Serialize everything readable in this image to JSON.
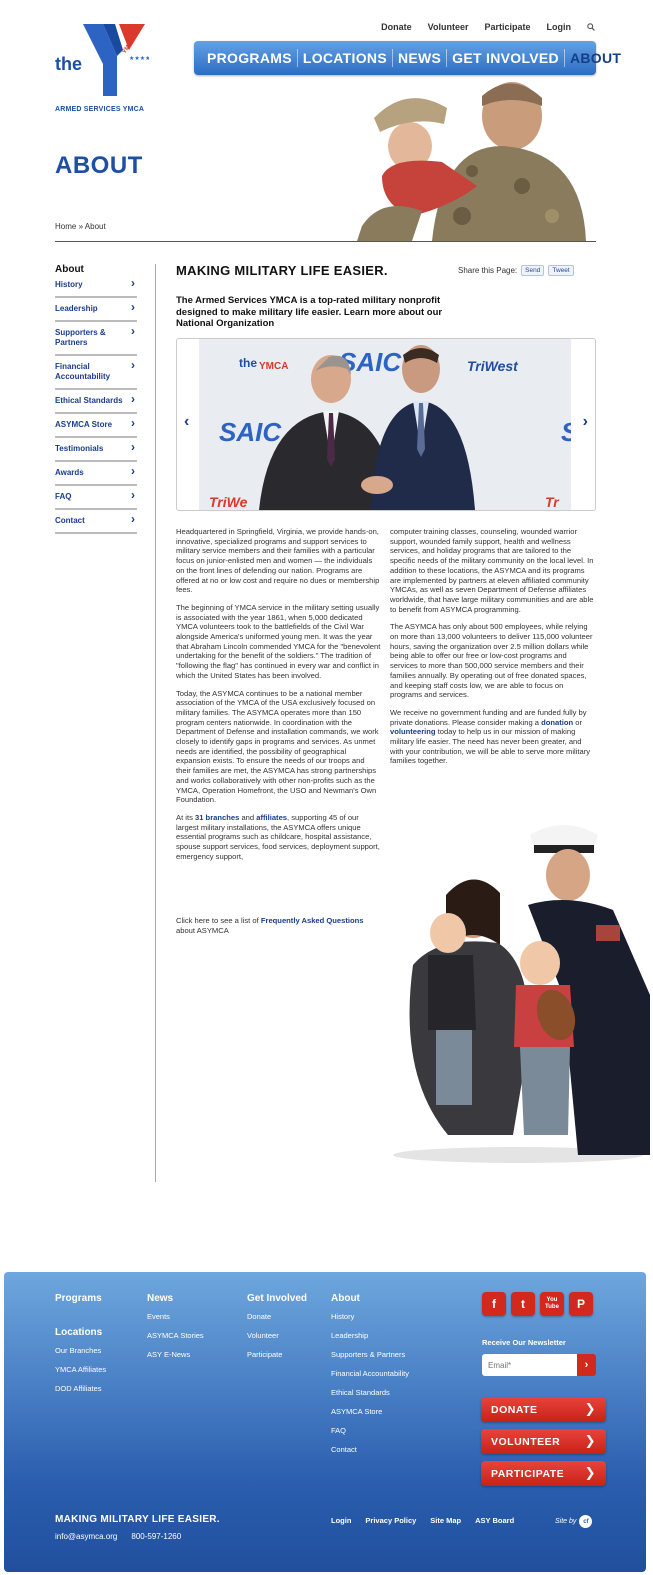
{
  "logo": {
    "the": "the",
    "ymca": "YMCA",
    "org": "ARMED SERVICES YMCA"
  },
  "util_nav": [
    "Donate",
    "Volunteer",
    "Participate",
    "Login"
  ],
  "main_nav": [
    "PROGRAMS",
    "LOCATIONS",
    "NEWS",
    "GET INVOLVED",
    "ABOUT"
  ],
  "page_title": "ABOUT",
  "breadcrumb": "Home » About",
  "sidebar": {
    "heading": "About",
    "items": [
      "History",
      "Leadership",
      "Supporters & Partners",
      "Financial Accountability",
      "Ethical Standards",
      "ASYMCA Store",
      "Testimonials",
      "Awards",
      "FAQ",
      "Contact"
    ]
  },
  "main": {
    "title": "MAKING MILITARY LIFE EASIER.",
    "share_label": "Share this Page:",
    "send_label": "Send",
    "tweet_label": "Tweet",
    "lead": "The Armed Services YMCA is a top-rated military nonprofit designed to make military life easier. Learn more about our National Organization",
    "slider_prev": "‹",
    "slider_next": "›",
    "slide_logos": {
      "saic": "SAIC",
      "triwest": "TriWest",
      "ymca": "YMCA",
      "the": "the"
    },
    "p1": "Headquartered in Springfield, Virginia, we provide hands-on, innovative, specialized programs and support services to military service members and their families with a particular focus on junior-enlisted men and women — the individuals on the front lines of defending our nation. Programs are offered at no or low cost and require no dues or membership fees.",
    "p2": "The beginning of YMCA service in the military setting usually is associated with the year 1861, when 5,000 dedicated YMCA volunteers took to the battlefields of the Civil War alongside America's uniformed young men. It was the year that Abraham Lincoln commended YMCA for the \"benevolent undertaking for the benefit of the soldiers.\" The tradition of \"following the flag\" has continued in every war and conflict in which the United States has been involved.",
    "p3": "Today, the ASYMCA continues to be a national member association of the YMCA of the USA exclusively focused on military families. The ASYMCA operates more than 150 program centers nationwide. In coordination with the Department of Defense and installation commands, we work closely to identify gaps in programs and services. As unmet needs are identified, the possibility of geographical expansion exists. To ensure the needs of our troops and their families are met, the ASYMCA has strong partnerships and works collaboratively with other non-profits such as the YMCA, Operation Homefront, the USO and Newman's Own Foundation.",
    "p4_a": "At its ",
    "p4_link1": "31 branches",
    "p4_b": " and ",
    "p4_link2": "affiliates",
    "p4_c": ", supporting 45 of our largest military installations, the ASYMCA offers unique essential programs such as childcare, hospital assistance, spouse support services, food services, deployment support, emergency support,",
    "p5": "computer training classes, counseling, wounded warrior support, wounded family support, health and wellness services, and holiday programs that are tailored to the specific needs of the military community on the local level. In addition to these locations, the ASYMCA and its programs are implemented by partners at eleven affiliated community YMCAs, as well as seven Department of Defense affiliates worldwide, that have large military communities and are able to benefit from ASYMCA programming.",
    "p6": "The ASYMCA has only about 500 employees, while relying on more than 13,000 volunteers to deliver 115,000 volunteer hours, saving the organization over 2.5 million dollars while being able to offer our free or low-cost programs and services to more than 500,000 service members and their families annually. By operating out of free donated spaces, and keeping staff costs low, we are able to focus on programs and services.",
    "p7_a": "We receive no government funding and are funded fully by private donations. Please consider making a ",
    "p7_link1": "donation",
    "p7_b": " or ",
    "p7_link2": "volunteering",
    "p7_c": " today to help us in our mission of making military life easier. The need has never been greater, and with your contribution, we will be able to serve more military families together.",
    "faq_a": "Click here to see a list of ",
    "faq_link": "Frequently Asked Questions",
    "faq_b": " about ASYMCA"
  },
  "footer": {
    "programs": "Programs",
    "locations": "Locations",
    "locations_links": [
      "Our Branches",
      "YMCA Affiliates",
      "DOD Affiliates"
    ],
    "news": "News",
    "news_links": [
      "Events",
      "ASYMCA Stories",
      "ASY E-News"
    ],
    "get_involved": "Get Involved",
    "get_involved_links": [
      "Donate",
      "Volunteer",
      "Participate"
    ],
    "about": "About",
    "about_links": [
      "History",
      "Leadership",
      "Supporters & Partners",
      "Financial Accountability",
      "Ethical Standards",
      "ASYMCA Store",
      "FAQ",
      "Contact"
    ],
    "social": [
      "f",
      "t",
      "You Tube",
      "P"
    ],
    "newsletter_label": "Receive Our Newsletter",
    "email_placeholder": "Email*",
    "email_go": "›",
    "cta": [
      "DONATE",
      "VOLUNTEER",
      "PARTICIPATE"
    ],
    "cta_chev": "❯",
    "tagline": "MAKING MILITARY LIFE EASIER.",
    "email": "info@asymca.org",
    "phone": "800-597-1260",
    "bottom_links": [
      "Login",
      "Privacy Policy",
      "Site Map",
      "ASY Board"
    ],
    "site_by": "Site by",
    "site_by_logo": "cf"
  },
  "colors": {
    "brand_blue": "#1d4fa3",
    "brand_red": "#d2291f",
    "nav_blue": "#2d6cc5"
  }
}
